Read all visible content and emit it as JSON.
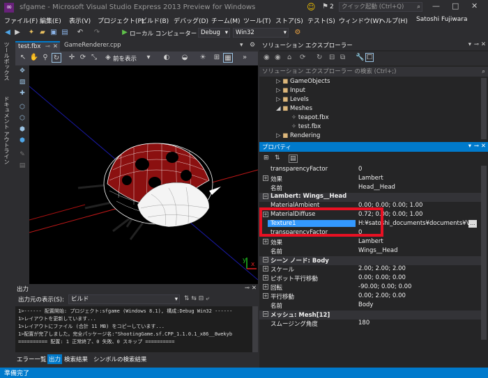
{
  "title": {
    "text": "sfgame - Microsoft Visual Studio Express 2013 Preview for Windows",
    "notifications": "2",
    "quick_launch": "クイック起動 (Ctrl+Q)"
  },
  "menu": [
    "ファイル(F)",
    "編集(E)",
    "表示(V)",
    "プロジェクト(P)",
    "ビルド(B)",
    "デバッグ(D)",
    "チーム(M)",
    "ツール(T)",
    "ストア(S)",
    "テスト(S)",
    "ウィンドウ(W)",
    "ヘルプ(H)"
  ],
  "user": "Satoshi Fujiwara",
  "toolbar": {
    "target": "ローカル コンピューター",
    "config": "Debug",
    "platform": "Win32"
  },
  "side_tabs": [
    "ツールボックス",
    "ドキュメント アウトライン"
  ],
  "doc_tabs": [
    "test.fbx",
    "GameRenderer.cpp"
  ],
  "graphics_toolbar": {
    "view_label": "前を表示"
  },
  "viewport": {
    "axis_y": "y",
    "axis_x": "x"
  },
  "output": {
    "title": "出力",
    "source_label": "出力元の表示(S):",
    "source_value": "ビルド",
    "lines": [
      "1>------ 配置開始: プロジェクト:sfgame (Windows 8.1), 構成:Debug Win32 ------",
      "1>レイアウトを更新しています...",
      "1>レイアウトにファイル (合計 11 MB) をコピーしています...",
      "1>配置が完了しました。完全パッケージ名:\"ShootingGame.sf.CPP_1.1.0.1_x86__8wekyb",
      "========== 配置: 1 正常終了、0 失敗、0 スキップ =========="
    ],
    "tabs": [
      "エラー一覧",
      "出力",
      "検索結果",
      "シンボルの検索結果"
    ]
  },
  "solution_explorer": {
    "title": "ソリューション エクスプローラー",
    "search_placeholder": "ソリューション エクスプローラー の検索 (Ctrl+;)",
    "items": [
      "GameObjects",
      "Input",
      "Levels",
      "Meshes",
      "teapot.fbx",
      "test.fbx",
      "Rendering"
    ]
  },
  "properties": {
    "title": "プロパティ",
    "rows": [
      {
        "name": "transparencyFactor",
        "value": "0"
      },
      {
        "name": "効果",
        "value": "Lambert"
      },
      {
        "name": "名前",
        "value": "Head__Head"
      },
      {
        "name": "Lambert: Wings__Head",
        "value": ""
      },
      {
        "name": "MaterialAmbient",
        "value": "0.00; 0.00; 0.00; 1.00"
      },
      {
        "name": "MaterialDiffuse",
        "value": "0.72; 0.00; 0.00; 1.00"
      },
      {
        "name": "Texture1",
        "value": "H:¥satoshi_documents¥documents¥Vi"
      },
      {
        "name": "transparencyFactor",
        "value": "0"
      },
      {
        "name": "効果",
        "value": "Lambert"
      },
      {
        "name": "名前",
        "value": "Wings__Head"
      },
      {
        "name": "シーン ノード: Body",
        "value": ""
      },
      {
        "name": "スケール",
        "value": "2.00; 2.00; 2.00"
      },
      {
        "name": "ピボット平行移動",
        "value": "0.00; 0.00; 0.00"
      },
      {
        "name": "回転",
        "value": "-90.00; 0.00; 0.00"
      },
      {
        "name": "平行移動",
        "value": "0.00; 2.00; 0.00"
      },
      {
        "name": "名前",
        "value": "Body"
      },
      {
        "name": "メッシュ: Mesh[12]",
        "value": ""
      },
      {
        "name": "スムージング角度",
        "value": "180"
      }
    ]
  },
  "status": "準備完了",
  "colors": {
    "accent": "#007acc",
    "highlight": "#e81123",
    "selection": "#3399ff"
  }
}
